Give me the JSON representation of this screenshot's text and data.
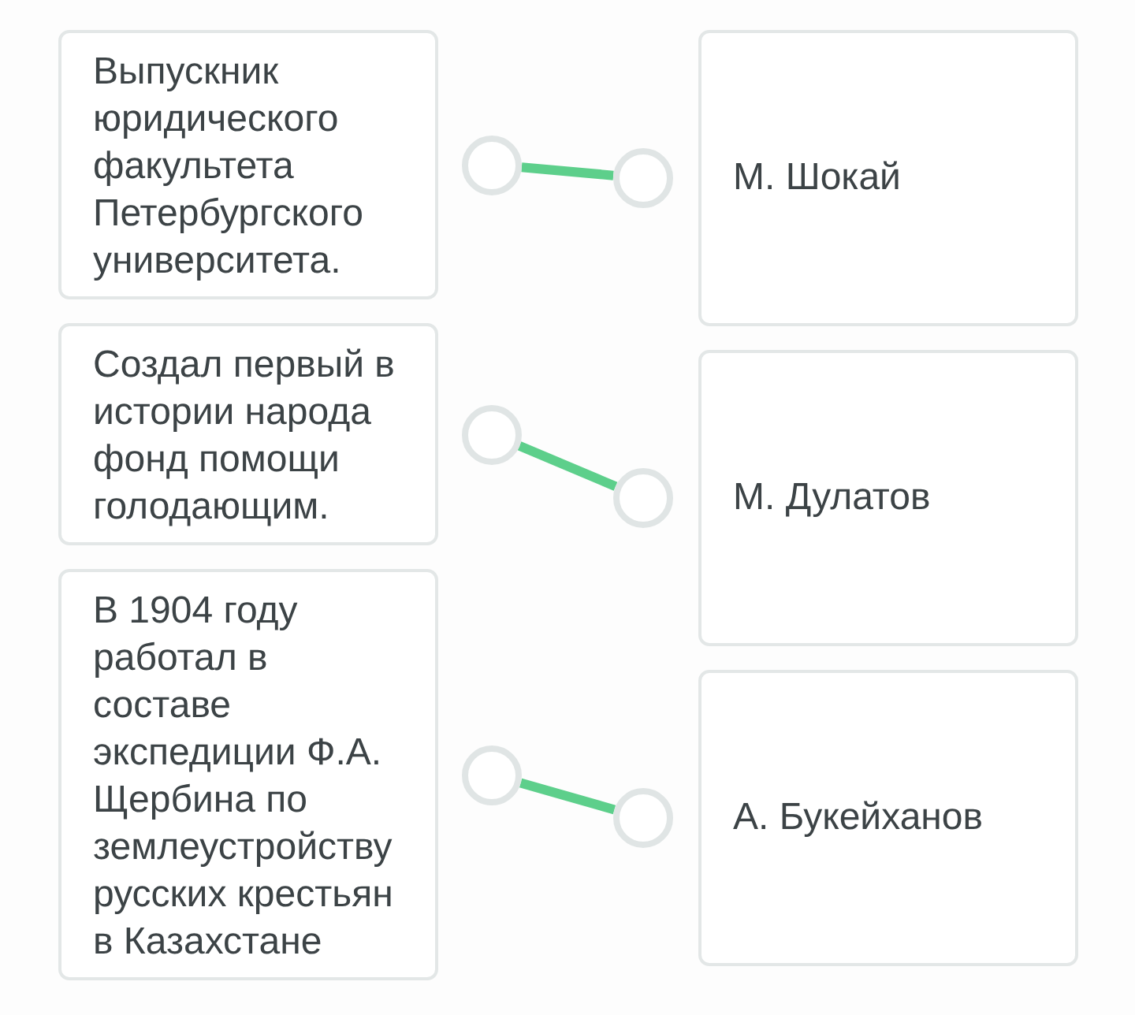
{
  "rows": [
    {
      "statement": "Выпускник юридического факультета Петербургского университета.",
      "answer": "М. Шокай",
      "connected": true
    },
    {
      "statement": "Создал первый в истории народа фонд помощи голодающим.",
      "answer": "М. Дулатов",
      "connected": true
    },
    {
      "statement": "В 1904 году работал в составе экспедиции Ф.А. Щербина по землеустройству русских крестьян в Казахстане",
      "answer": "А. Букейханов",
      "connected": true
    }
  ]
}
